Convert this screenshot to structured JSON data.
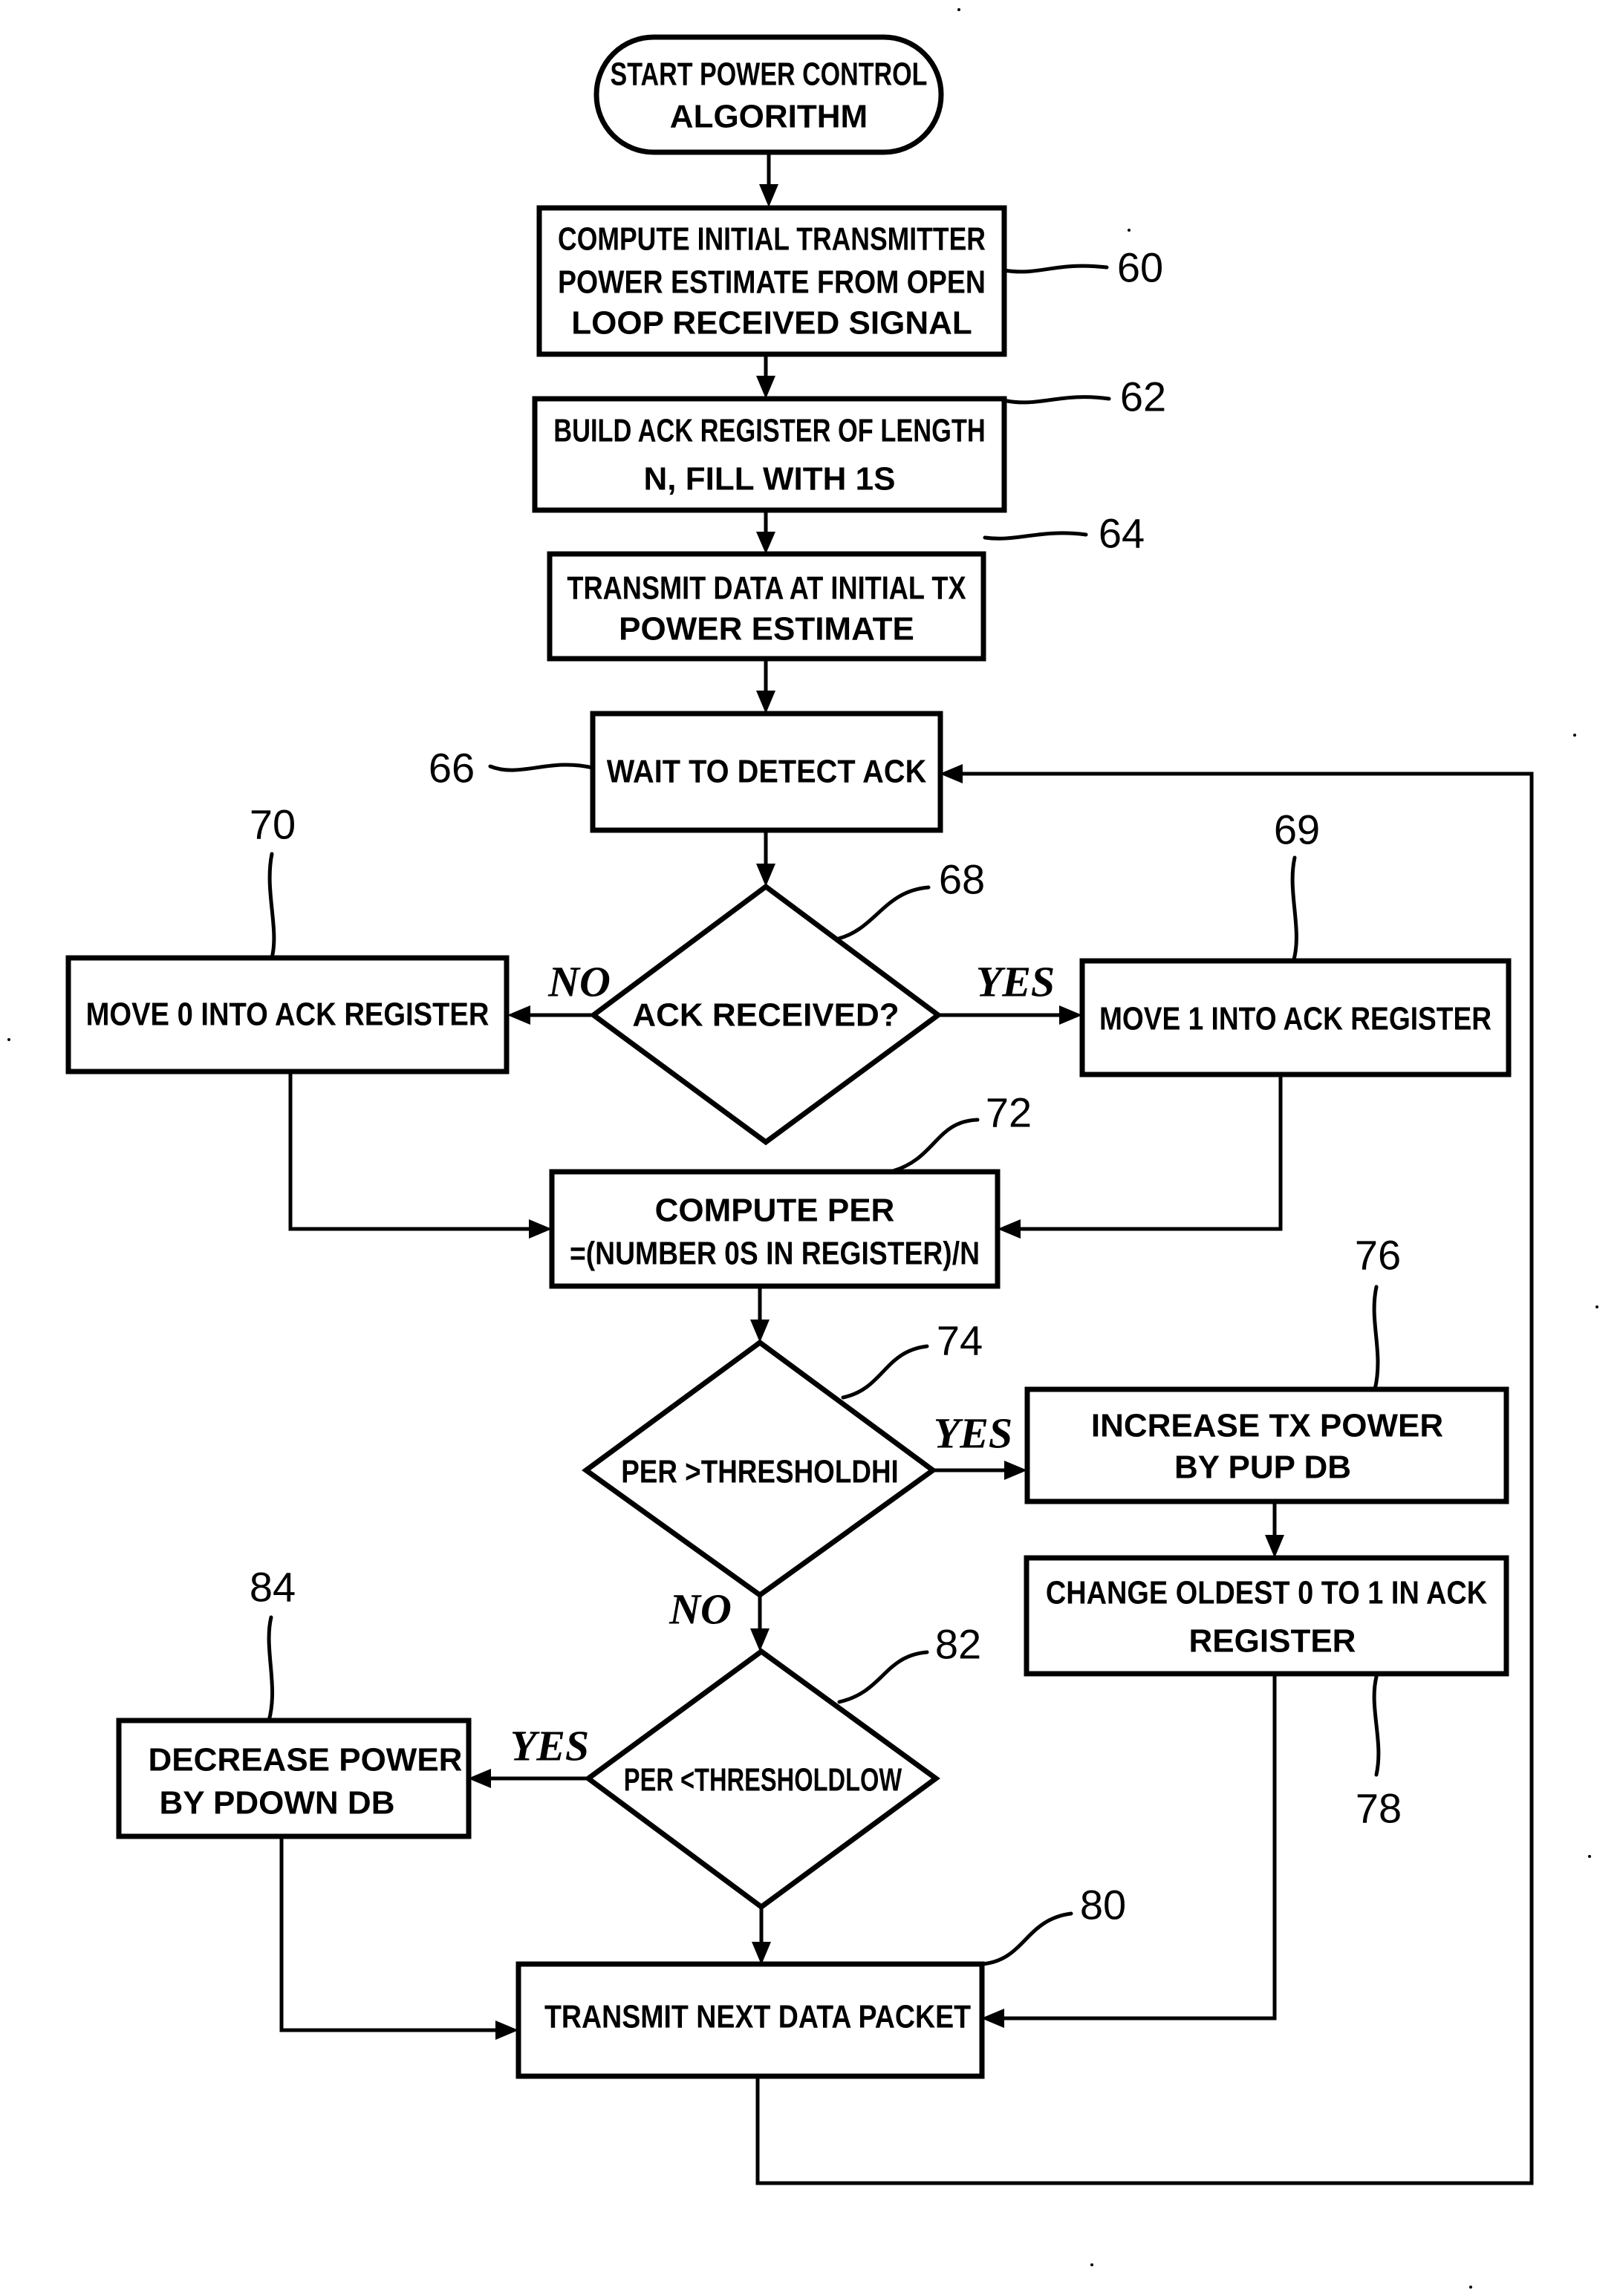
{
  "diagram": {
    "type": "flowchart",
    "title": "Power control algorithm flowchart",
    "nodes": {
      "start": {
        "shape": "terminal",
        "lines": [
          "START POWER CONTROL",
          "ALGORITHM"
        ]
      },
      "n60": {
        "ref": "60",
        "shape": "process",
        "lines": [
          "COMPUTE INITIAL TRANSMITTER",
          "POWER ESTIMATE FROM OPEN",
          "LOOP RECEIVED SIGNAL"
        ]
      },
      "n62": {
        "ref": "62",
        "shape": "process",
        "lines": [
          "BUILD ACK REGISTER OF LENGTH",
          "N, FILL WITH 1S"
        ]
      },
      "n64": {
        "ref": "64",
        "shape": "process",
        "lines": [
          "TRANSMIT DATA AT INITIAL TX",
          "POWER ESTIMATE"
        ]
      },
      "n66": {
        "ref": "66",
        "shape": "process",
        "lines": [
          "WAIT TO DETECT ACK"
        ]
      },
      "n68": {
        "ref": "68",
        "shape": "decision",
        "lines": [
          "ACK RECEIVED?"
        ]
      },
      "n70": {
        "ref": "70",
        "shape": "process",
        "lines": [
          "MOVE 0 INTO ACK REGISTER"
        ]
      },
      "n69": {
        "ref": "69",
        "shape": "process",
        "lines": [
          "MOVE 1 INTO ACK REGISTER"
        ]
      },
      "n72": {
        "ref": "72",
        "shape": "process",
        "lines": [
          "COMPUTE PER",
          "=(NUMBER 0S IN REGISTER)/N"
        ]
      },
      "n74": {
        "ref": "74",
        "shape": "decision",
        "lines": [
          "PER >THRESHOLDHI"
        ]
      },
      "n76": {
        "ref": "76",
        "shape": "process",
        "lines": [
          "INCREASE TX POWER",
          "BY PUP DB"
        ]
      },
      "n78": {
        "ref": "78",
        "shape": "process",
        "lines": [
          "CHANGE OLDEST 0 TO 1 IN ACK",
          "REGISTER"
        ]
      },
      "n82": {
        "ref": "82",
        "shape": "decision",
        "lines": [
          "PER <THRESHOLDLOW"
        ]
      },
      "n84": {
        "ref": "84",
        "shape": "process",
        "lines": [
          "DECREASE POWER",
          "BY PDOWN DB"
        ]
      },
      "n80": {
        "ref": "80",
        "shape": "process",
        "lines": [
          "TRANSMIT NEXT DATA PACKET"
        ]
      }
    },
    "branch_labels": {
      "d68_no": "NO",
      "d68_yes": "YES",
      "d74_yes": "YES",
      "d74_no": "NO",
      "d82_yes": "YES"
    },
    "edges": [
      {
        "from": "start",
        "to": "n60"
      },
      {
        "from": "n60",
        "to": "n62"
      },
      {
        "from": "n62",
        "to": "n64"
      },
      {
        "from": "n64",
        "to": "n66"
      },
      {
        "from": "n66",
        "to": "n68"
      },
      {
        "from": "n68",
        "to": "n70",
        "label": "NO"
      },
      {
        "from": "n68",
        "to": "n69",
        "label": "YES"
      },
      {
        "from": "n70",
        "to": "n72"
      },
      {
        "from": "n69",
        "to": "n72"
      },
      {
        "from": "n72",
        "to": "n74"
      },
      {
        "from": "n74",
        "to": "n76",
        "label": "YES"
      },
      {
        "from": "n74",
        "to": "n82",
        "label": "NO"
      },
      {
        "from": "n76",
        "to": "n78"
      },
      {
        "from": "n78",
        "to": "n80"
      },
      {
        "from": "n82",
        "to": "n84",
        "label": "YES"
      },
      {
        "from": "n82",
        "to": "n80"
      },
      {
        "from": "n84",
        "to": "n80"
      },
      {
        "from": "n80",
        "to": "n66"
      }
    ]
  }
}
